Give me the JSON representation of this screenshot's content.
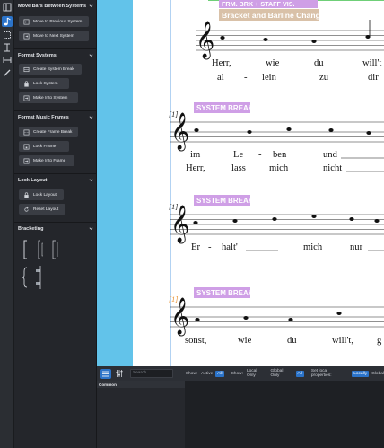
{
  "panel": {
    "sections": [
      {
        "title": "Move Bars Between Systems",
        "buttons": [
          "Move to Previous System",
          "Move to Next System"
        ]
      },
      {
        "title": "Format Systems",
        "buttons": [
          "Create System Break",
          "Lock System",
          "Make Into System"
        ]
      },
      {
        "title": "Format Music Frames",
        "buttons": [
          "Create Frame Break",
          "Lock Frame",
          "Make Into Frame"
        ]
      },
      {
        "title": "Lock Layout",
        "buttons": [
          "Lock Layout",
          "Reset Layout"
        ]
      },
      {
        "title": "Bracketing",
        "buttons": []
      }
    ]
  },
  "score": {
    "frame_banner": "FRM. BRK + STAFF VIS.",
    "bracket_label": "Bracket and Barline Change",
    "system_break_label": "SYSTEM BREAK",
    "bar_numbers": [
      "[1]",
      "[1]",
      "[1]"
    ],
    "systems": [
      {
        "lyrics": [
          [
            "Herr,",
            "wie",
            "du",
            "will't"
          ],
          [
            "al",
            "-",
            "lein",
            "zu",
            "dir"
          ]
        ]
      },
      {
        "lyrics": [
          [
            "im",
            "Le",
            "-",
            "ben",
            "und"
          ],
          [
            "Herr,",
            "lass",
            "mich",
            "nicht"
          ]
        ]
      },
      {
        "lyrics": [
          [
            "Er",
            "-",
            "halt'",
            "mich",
            "nur"
          ]
        ]
      },
      {
        "lyrics": [
          [
            "sonst,",
            "wie",
            "du",
            "will't,",
            "g"
          ]
        ]
      }
    ]
  },
  "bottombar": {
    "search_placeholder": "Search...",
    "show_label": "Show:",
    "active": "Active",
    "all": "All",
    "local_only": "Local Only",
    "global_only": "Global Only",
    "set_local_label": "Set local properties:",
    "locally": "Locally",
    "globally": "Global"
  },
  "properties": {
    "common_heading": "Common"
  },
  "colors": {
    "accent": "#2b73c9",
    "margin": "#62c3ea",
    "system_break": "#cf9fe6",
    "bracket_label": "#d9c1a8"
  }
}
